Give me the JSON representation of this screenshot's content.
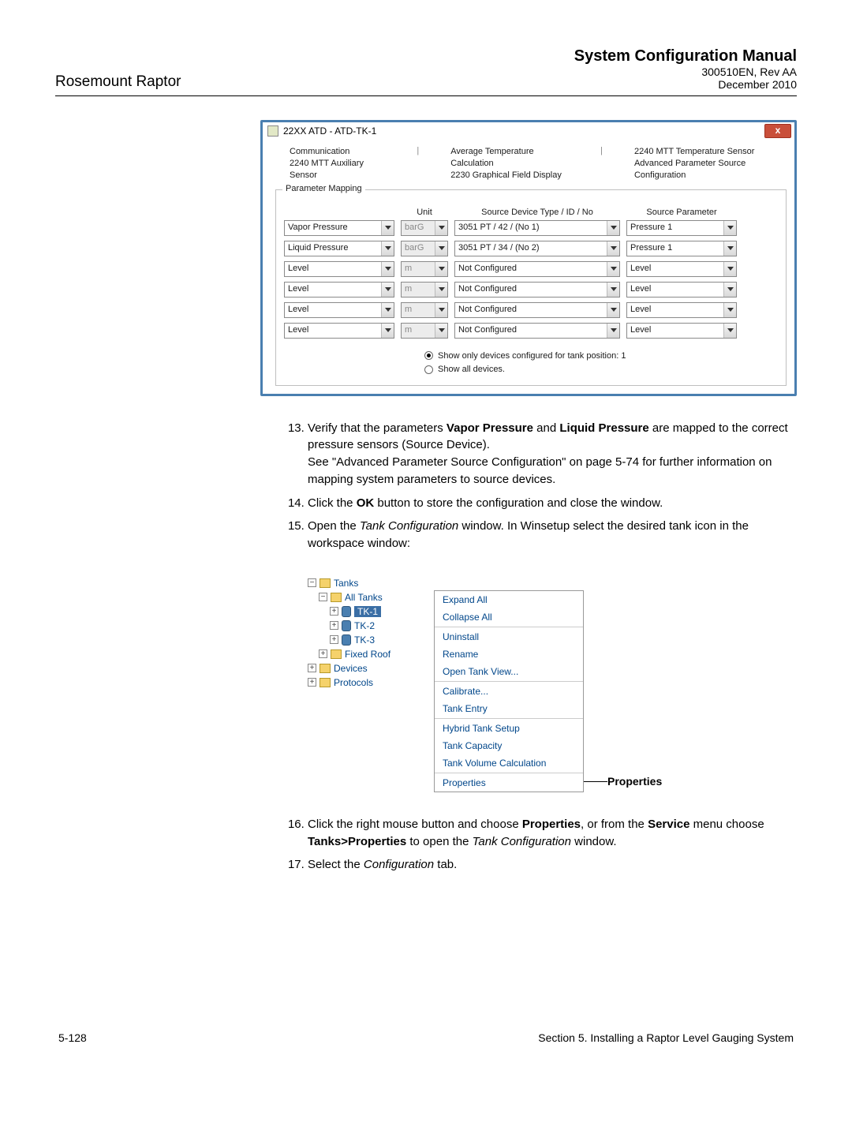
{
  "header": {
    "product": "Rosemount Raptor",
    "manual_title": "System Configuration Manual",
    "docnum": "300510EN, Rev AA",
    "date": "December 2010"
  },
  "window1": {
    "title": "22XX ATD  - ATD-TK-1",
    "tabs": {
      "col1a": "Communication",
      "col1b": "2240 MTT Auxiliary Sensor",
      "col2a": "Average Temperature Calculation",
      "col2b": "2230 Graphical Field Display",
      "col3a": "2240 MTT Temperature Sensor",
      "col3b": "Advanced Parameter Source Configuration"
    },
    "group_legend": "Parameter Mapping",
    "headers": {
      "c1": "",
      "c2": "Unit",
      "c3": "Source Device Type / ID / No",
      "c4": "Source Parameter"
    },
    "rows": [
      {
        "param": "Vapor Pressure",
        "unit": "barG",
        "source": "3051 PT / 42 / (No 1)",
        "sp": "Pressure 1"
      },
      {
        "param": "Liquid Pressure",
        "unit": "barG",
        "source": "3051 PT / 34 / (No 2)",
        "sp": "Pressure 1"
      },
      {
        "param": "Level",
        "unit": "m",
        "source": "Not Configured",
        "sp": "Level"
      },
      {
        "param": "Level",
        "unit": "m",
        "source": "Not Configured",
        "sp": "Level"
      },
      {
        "param": "Level",
        "unit": "m",
        "source": "Not Configured",
        "sp": "Level"
      },
      {
        "param": "Level",
        "unit": "m",
        "source": "Not Configured",
        "sp": "Level"
      }
    ],
    "radio_a": "Show only devices configured for tank position:   1",
    "radio_b": "Show all devices."
  },
  "steps": {
    "s13_a": "Verify that the parameters ",
    "s13_b1": "Vapor Pressure",
    "s13_c": " and ",
    "s13_b2": "Liquid Pressure",
    "s13_d": " are mapped to the correct pressure sensors (Source Device).",
    "s13_e": "See \"Advanced Parameter Source Configuration\" on page 5-74 for further information on mapping system parameters to source devices.",
    "s14_a": "Click the ",
    "s14_b": "OK",
    "s14_c": " button to store the configuration and close the window.",
    "s15_a": "Open the ",
    "s15_i": "Tank Configuration",
    "s15_b": " window. In Winsetup select the desired tank icon in the workspace window:",
    "s16_a": "Click the right mouse button and choose ",
    "s16_b": "Properties",
    "s16_c": ", or from the ",
    "s16_d": "Service",
    "s16_e": " menu choose ",
    "s16_f": "Tanks>Properties",
    "s16_g": " to open the ",
    "s16_i": "Tank Configuration",
    "s16_h": " window.",
    "s17_a": "Select the ",
    "s17_i": "Configuration",
    "s17_b": " tab."
  },
  "tree": {
    "tanks": "Tanks",
    "all_tanks": "All Tanks",
    "tk1": "TK-1",
    "tk2": "TK-2",
    "tk3": "TK-3",
    "fixed_roof": "Fixed Roof",
    "devices": "Devices",
    "protocols": "Protocols"
  },
  "menu": {
    "expand": "Expand All",
    "collapse": "Collapse All",
    "uninstall": "Uninstall",
    "rename": "Rename",
    "open_tank_view": "Open Tank View...",
    "calibrate": "Calibrate...",
    "tank_entry": "Tank Entry",
    "hybrid": "Hybrid Tank Setup",
    "capacity": "Tank Capacity",
    "volume": "Tank Volume Calculation",
    "properties": "Properties"
  },
  "props_label": "Properties",
  "footer": {
    "left": "5-128",
    "right": "Section 5. Installing a Raptor Level Gauging System"
  }
}
